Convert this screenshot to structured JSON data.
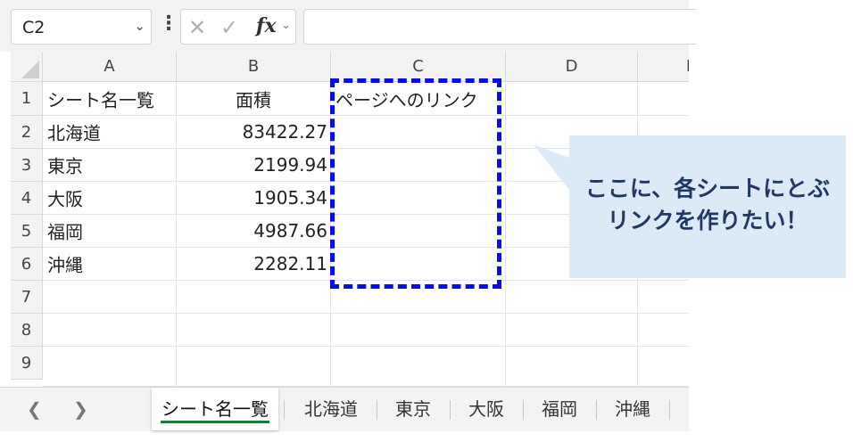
{
  "formula_bar": {
    "name_box": "C2",
    "fx_label": "fx",
    "formula_value": ""
  },
  "columns": [
    "A",
    "B",
    "C",
    "D",
    "E"
  ],
  "rows": [
    "1",
    "2",
    "3",
    "4",
    "5",
    "6",
    "7",
    "8",
    "9"
  ],
  "cells": {
    "A1": "シート名一覧",
    "B1": "面積",
    "C1": "ページへのリンク",
    "A2": "北海道",
    "B2": "83422.27",
    "A3": "東京",
    "B3": "2199.94",
    "A4": "大阪",
    "B4": "1905.34",
    "A5": "福岡",
    "B5": "4987.66",
    "A6": "沖縄",
    "B6": "2282.11"
  },
  "callout": {
    "line1": "ここに、各シートにとぶ",
    "line2": "リンクを作りたい！"
  },
  "sheet_tabs": [
    "シート名一覧",
    "北海道",
    "東京",
    "大阪",
    "福岡",
    "沖縄"
  ],
  "active_tab": "シート名一覧",
  "colors": {
    "dash_border": "#0a0af0",
    "callout_bg": "#dce9f6",
    "callout_text": "#1f3864",
    "active_tab_underline": "#1d7a3e"
  }
}
